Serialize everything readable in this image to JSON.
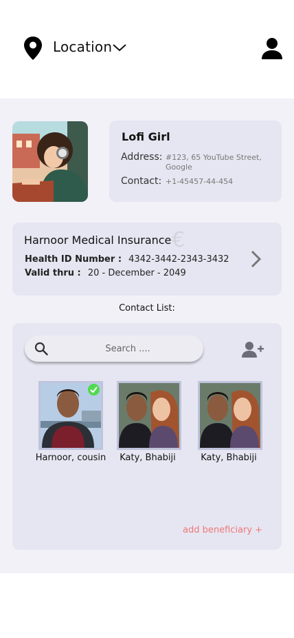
{
  "header": {
    "location_label": "Location",
    "location_icon": "map-pin-icon",
    "dropdown_icon": "chevron-down-icon",
    "profile_icon": "user-icon"
  },
  "profile": {
    "name": "Lofi Girl",
    "address_label": "Address:",
    "address_value": "#123, 65 YouTube Street, Google",
    "contact_label": "Contact:",
    "contact_value": "+1-45457-44-454"
  },
  "insurance": {
    "title": "Harnoor Medical Insurance",
    "currency_symbol": "€",
    "health_id_label": "Health ID Number :",
    "health_id_value": "4342-3442-2343-3432",
    "valid_label": "Valid thru :",
    "valid_value": "20 - December - 2049"
  },
  "contacts": {
    "heading": "Contact List:",
    "search_placeholder": "Search ....",
    "add_user_icon": "add-user-icon",
    "items": [
      {
        "name": "Harnoor, cousin",
        "selected": true
      },
      {
        "name": "Katy, Bhabiji",
        "selected": false
      },
      {
        "name": "Katy, Bhabiji",
        "selected": false
      }
    ],
    "add_beneficiary_label": "add beneficiary +"
  },
  "colors": {
    "page_bg": "#f1f1f7",
    "card_bg": "#e6e6f2",
    "accent_pink": "#ef7777",
    "check_green": "#52d94f"
  }
}
